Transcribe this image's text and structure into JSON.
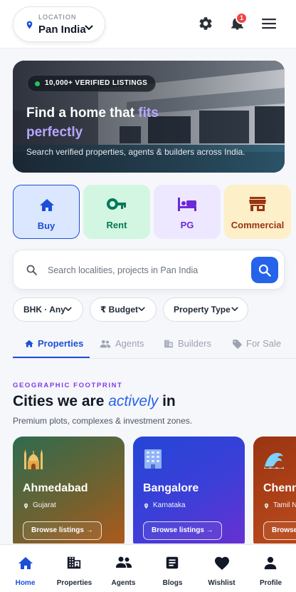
{
  "header": {
    "location_caption": "LOCATION",
    "location_value": "Pan India",
    "notification_count": "1",
    "icons": [
      "location-pin-icon",
      "chevron-down-icon",
      "gear-icon",
      "bell-icon",
      "hamburger-menu-icon"
    ]
  },
  "hero": {
    "badge": "10,000+ VERIFIED LISTINGS",
    "title_plain": "Find a home that ",
    "title_accent_1": "fits",
    "title_accent_2": "perfectly",
    "subtitle": "Search verified properties, agents & builders across India."
  },
  "categories": [
    {
      "label": "Buy",
      "icon": "home-icon",
      "color": "#1d4ed8",
      "bg": "#dbe7fe",
      "selected": true
    },
    {
      "label": "Rent",
      "icon": "key-icon",
      "color": "#047857",
      "bg": "#d3f6e3",
      "selected": false
    },
    {
      "label": "PG",
      "icon": "bed-icon",
      "color": "#6d28d9",
      "bg": "#ede8ff",
      "selected": false
    },
    {
      "label": "Commercial",
      "icon": "storefront-icon",
      "color": "#9a3412",
      "bg": "#fdefc8",
      "selected": false
    }
  ],
  "search": {
    "placeholder": "Search localities, projects in Pan India",
    "value": ""
  },
  "filters": [
    {
      "label": "BHK · Any"
    },
    {
      "label": "₹ Budget"
    },
    {
      "label": "Property Type"
    }
  ],
  "tabs": [
    {
      "label": "Properties",
      "icon": "home-icon",
      "active": true
    },
    {
      "label": "Agents",
      "icon": "people-icon",
      "active": false
    },
    {
      "label": "Builders",
      "icon": "building-icon",
      "active": false
    },
    {
      "label": "For Sale",
      "icon": "tag-icon",
      "active": false
    }
  ],
  "section": {
    "eyebrow": "GEOGRAPHIC FOOTPRINT",
    "title_plain_1": "Cities we are ",
    "title_accent": "actively",
    "title_plain_2": " in",
    "subtitle": "Premium plots, complexes & investment zones."
  },
  "cities": [
    {
      "name": "Ahmedabad",
      "state": "Gujarat",
      "button": "Browse listings →",
      "icon": "mosque-icon",
      "gradient": [
        "#2f6b4f",
        "#b3591a"
      ]
    },
    {
      "name": "Bangalore",
      "state": "Karnataka",
      "button": "Browse listings →",
      "icon": "office-building-icon",
      "gradient": [
        "#2446d6",
        "#6b2fd1"
      ]
    },
    {
      "name": "Chennai",
      "state": "Tamil Nadu",
      "button": "Browse listings →",
      "icon": "wave-icon",
      "gradient": [
        "#9a3412",
        "#c2410c"
      ]
    }
  ],
  "bottom_nav": [
    {
      "label": "Home",
      "icon": "home-icon",
      "active": true
    },
    {
      "label": "Properties",
      "icon": "buildings-icon",
      "active": false
    },
    {
      "label": "Agents",
      "icon": "people-icon",
      "active": false
    },
    {
      "label": "Blogs",
      "icon": "article-icon",
      "active": false
    },
    {
      "label": "Wishlist",
      "icon": "heart-icon",
      "active": false
    },
    {
      "label": "Profile",
      "icon": "person-icon",
      "active": false
    }
  ]
}
